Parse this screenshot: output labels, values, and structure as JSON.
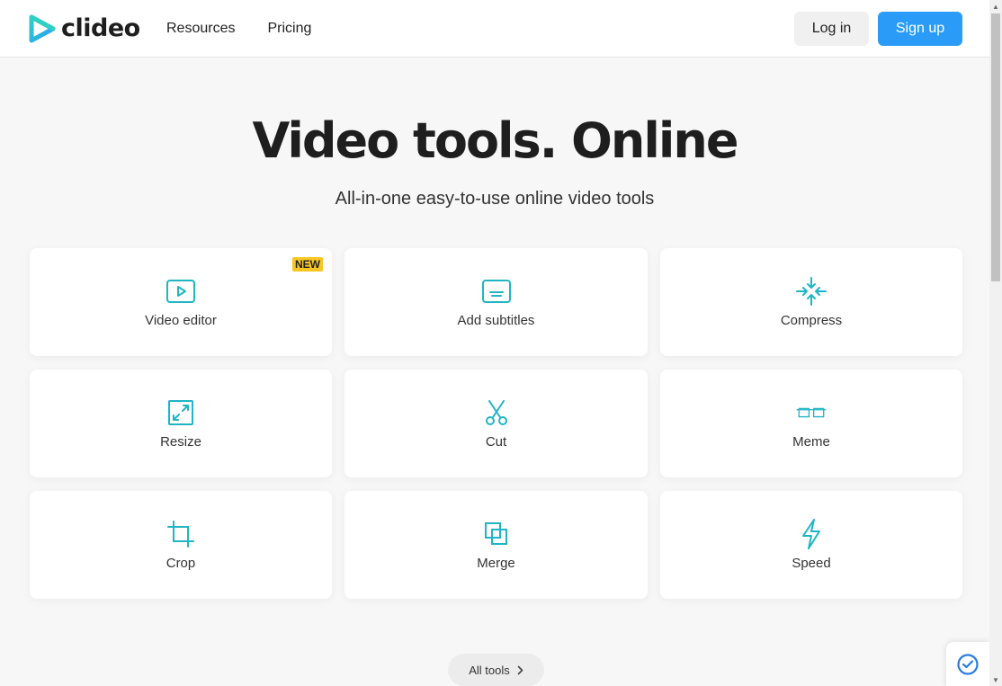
{
  "header": {
    "logo_text": "clideo",
    "nav": [
      {
        "label": "Resources"
      },
      {
        "label": "Pricing"
      }
    ],
    "login_label": "Log in",
    "signup_label": "Sign up"
  },
  "hero": {
    "title": "Video tools. Online",
    "subtitle": "All-in-one easy-to-use online video tools"
  },
  "tools": [
    {
      "label": "Video editor",
      "icon": "video-play-icon",
      "badge": "NEW"
    },
    {
      "label": "Add subtitles",
      "icon": "subtitles-icon"
    },
    {
      "label": "Compress",
      "icon": "compress-arrows-icon"
    },
    {
      "label": "Resize",
      "icon": "resize-icon"
    },
    {
      "label": "Cut",
      "icon": "scissors-icon"
    },
    {
      "label": "Meme",
      "icon": "glasses-icon"
    },
    {
      "label": "Crop",
      "icon": "crop-icon"
    },
    {
      "label": "Merge",
      "icon": "merge-icon"
    },
    {
      "label": "Speed",
      "icon": "lightning-icon"
    }
  ],
  "all_tools_label": "All tools",
  "colors": {
    "accent": "#2a9cf8",
    "icon_teal": "#1fb5c4",
    "badge": "#f7c623",
    "text_dark": "#1e1e1e"
  }
}
